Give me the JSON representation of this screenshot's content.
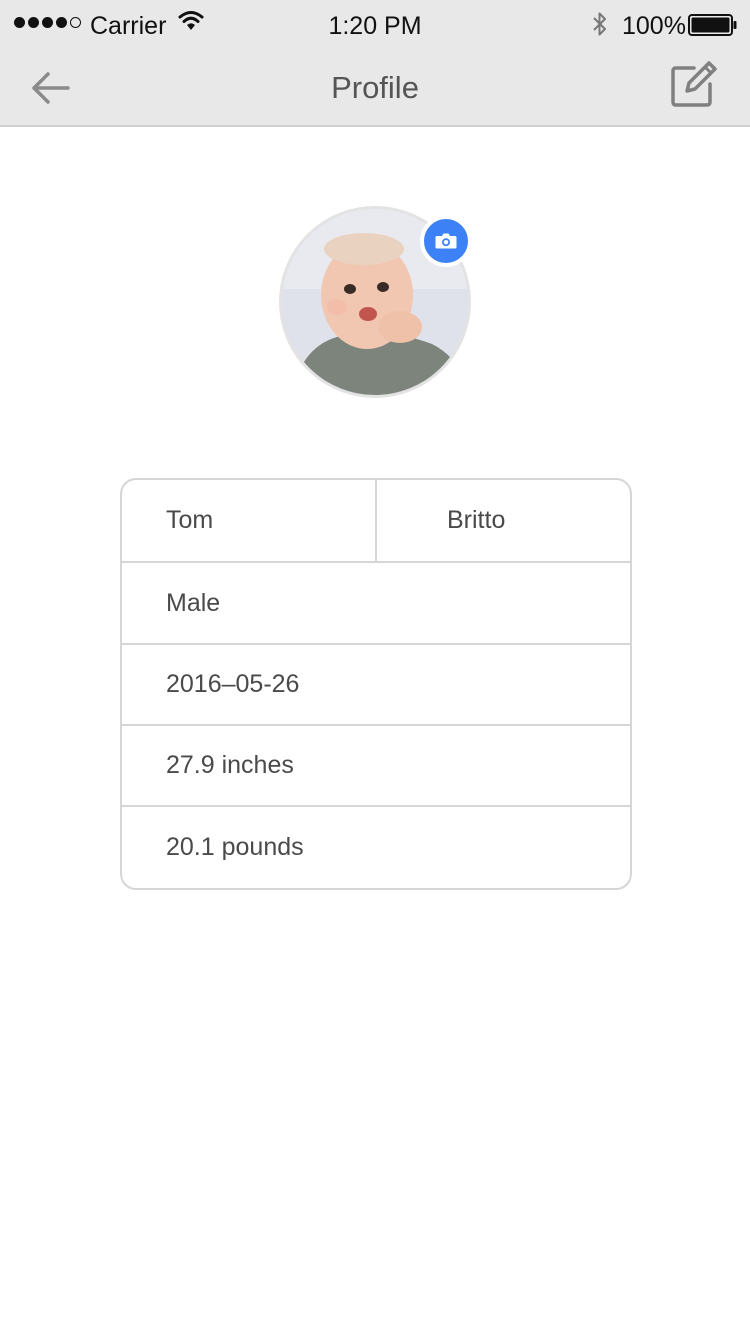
{
  "status_bar": {
    "carrier": "Carrier",
    "time": "1:20 PM",
    "battery": "100%"
  },
  "nav": {
    "title": "Profile",
    "back_icon": "arrow-left-icon",
    "edit_icon": "edit-icon"
  },
  "profile": {
    "avatar": "baby-photo",
    "camera_icon": "camera-icon",
    "accent_color": "#3c82f6"
  },
  "fields": {
    "first_name": "Tom",
    "last_name": "Britto",
    "gender": "Male",
    "birth_date": "2016–05-26",
    "height": "27.9 inches",
    "weight": "20.1 pounds"
  }
}
